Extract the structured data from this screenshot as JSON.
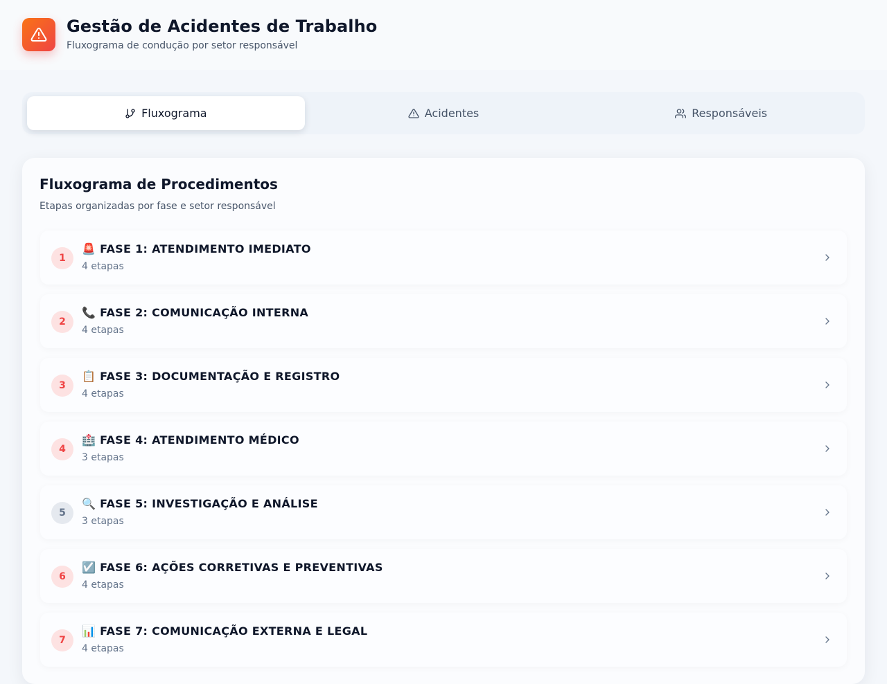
{
  "app": {
    "title": "Gestão de Acidentes de Trabalho",
    "subtitle": "Fluxograma de condução por setor responsável",
    "accent": "#ef4444"
  },
  "tabs": [
    {
      "label": "Fluxograma",
      "icon": "git-branch-icon",
      "active": true
    },
    {
      "label": "Acidentes",
      "icon": "alert-triangle-icon",
      "active": false
    },
    {
      "label": "Responsáveis",
      "icon": "users-icon",
      "active": false
    }
  ],
  "main": {
    "title": "Fluxograma de Procedimentos",
    "subtitle": "Etapas organizadas por fase e setor responsável",
    "phases": [
      {
        "number": "1",
        "title": "🚨 FASE 1: ATENDIMENTO IMEDIATO",
        "count": "4 etapas"
      },
      {
        "number": "2",
        "title": "📞 FASE 2: COMUNICAÇÃO INTERNA",
        "count": "4 etapas"
      },
      {
        "number": "3",
        "title": "📋 FASE 3: DOCUMENTAÇÃO E REGISTRO",
        "count": "4 etapas"
      },
      {
        "number": "4",
        "title": "🏥 FASE 4: ATENDIMENTO MÉDICO",
        "count": "3 etapas"
      },
      {
        "number": "5",
        "title": "🔍 FASE 5: INVESTIGAÇÃO E ANÁLISE",
        "count": "3 etapas"
      },
      {
        "number": "6",
        "title": "☑️ FASE 6: AÇÕES CORRETIVAS E PREVENTIVAS",
        "count": "4 etapas"
      },
      {
        "number": "7",
        "title": "📊 FASE 7: COMUNICAÇÃO EXTERNA E LEGAL",
        "count": "4 etapas"
      }
    ]
  }
}
